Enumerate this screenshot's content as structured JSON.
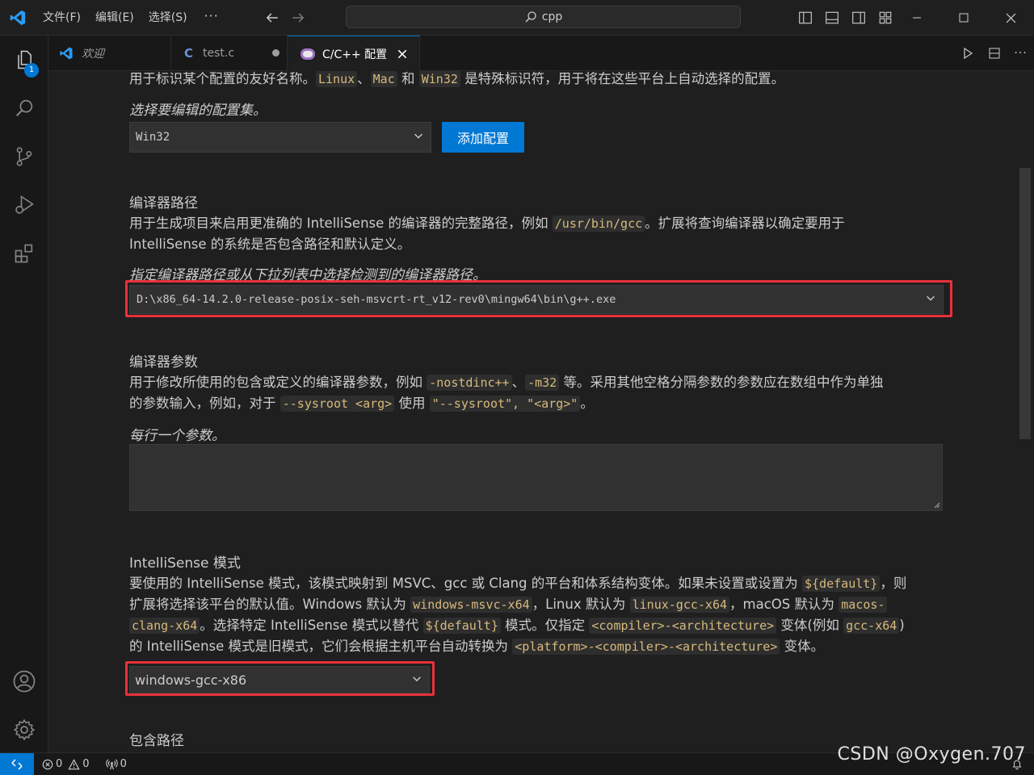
{
  "titlebar": {
    "menus": [
      "文件(F)",
      "编辑(E)",
      "选择(S)"
    ],
    "more": "···",
    "search": "cpp"
  },
  "activity": {
    "explorer_badge": "1"
  },
  "tabs": [
    {
      "label": "欢迎",
      "italic": true
    },
    {
      "label": "test.c",
      "modified": true
    },
    {
      "label": "C/C++ 配置",
      "active": true
    }
  ],
  "config": {
    "name_desc_prefix": "用于标识某个配置的友好名称。",
    "name_code_linux": "Linux",
    "name_sep1": "、",
    "name_code_mac": "Mac",
    "name_and": " 和 ",
    "name_code_win32": "Win32",
    "name_desc_suffix": " 是特殊标识符，用于将在这些平台上自动选择的配置。",
    "select_config_label": "选择要编辑的配置集。",
    "config_value": "Win32",
    "add_config_button": "添加配置",
    "compiler_path_heading": "编译器路径",
    "compiler_desc_1a": "用于生成项目来启用更准确的 IntelliSense 的编译器的完整路径，例如 ",
    "compiler_desc_code": "/usr/bin/gcc",
    "compiler_desc_1b": "。扩展将查询编译器以确定要用于",
    "compiler_desc_2": "IntelliSense 的系统是否包含路径和默认定义。",
    "compiler_instruction": "指定编译器路径或从下拉列表中选择检测到的编译器路径。",
    "compiler_value": "D:\\x86_64-14.2.0-release-posix-seh-msvcrt-rt_v12-rev0\\mingw64\\bin\\g++.exe",
    "args_heading": "编译器参数",
    "args_desc_1a": "用于修改所使用的包含或定义的编译器参数，例如 ",
    "args_code_1": "-nostdinc++",
    "args_sep": "、",
    "args_code_2": "-m32",
    "args_desc_1b": " 等。采用其他空格分隔参数的参数应在数组中作为单独",
    "args_desc_2a": "的参数输入，例如，对于 ",
    "args_code_3": "--sysroot <arg>",
    "args_desc_2b": " 使用 ",
    "args_code_4": "\"--sysroot\", \"<arg>\"",
    "args_desc_2c": "。",
    "args_instruction": "每行一个参数。",
    "isense_heading": "IntelliSense 模式",
    "is_l1a": "要使用的 IntelliSense 模式，该模式映射到 MSVC、gcc 或 Clang 的平台和体系结构变体。如果未设置或设置为 ",
    "is_code_default": "${default}",
    "is_l1b": "，则",
    "is_l2a": "扩展将选择该平台的默认值。Windows 默认为 ",
    "is_code_win": "windows-msvc-x64",
    "is_l2b": "，Linux 默认为 ",
    "is_code_linux": "linux-gcc-x64",
    "is_l2c": "，macOS 默认为 ",
    "is_code_mac1": "macos-",
    "is_code_mac2": "clang-x64",
    "is_l3a": "。选择特定 IntelliSense 模式以替代 ",
    "is_code_default2": "${default}",
    "is_l3b": " 模式。仅指定 ",
    "is_code_ca": "<compiler>-<architecture>",
    "is_l3c": " 变体(例如 ",
    "is_code_gcc": "gcc-x64",
    "is_l3d": ")",
    "is_l4a": "的 IntelliSense 模式是旧模式，它们会根据主机平台自动转换为 ",
    "is_code_pca": "<platform>-<compiler>-<architecture>",
    "is_l4b": " 变体。",
    "isense_value": "windows-gcc-x86",
    "include_heading": "包含路径"
  },
  "status": {
    "errors": "0",
    "warnings": "0",
    "ports": "0"
  },
  "watermark": "CSDN @Oxygen.707"
}
